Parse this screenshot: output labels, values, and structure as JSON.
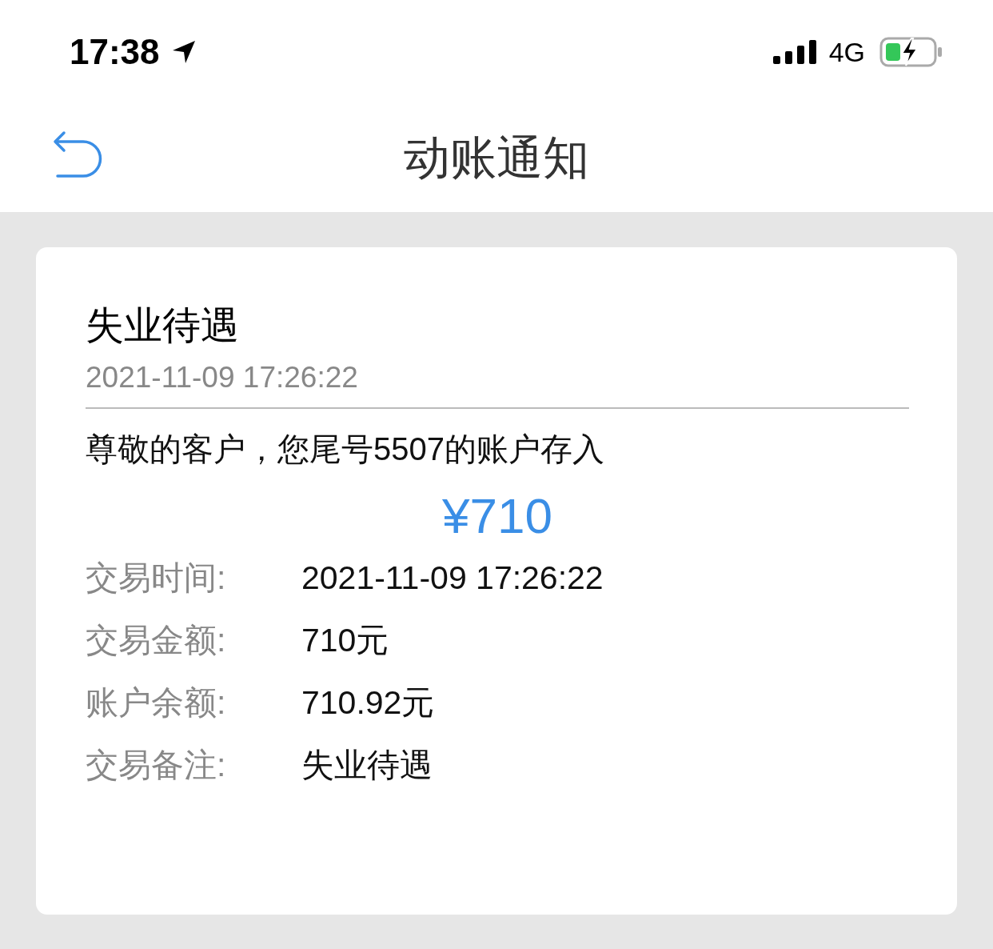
{
  "status_bar": {
    "time": "17:38",
    "network": "4G"
  },
  "nav": {
    "title": "动账通知"
  },
  "card": {
    "title": "失业待遇",
    "timestamp": "2021-11-09 17:26:22",
    "message": "尊敬的客户，您尾号5507的账户存入",
    "amount": "¥710",
    "details": [
      {
        "label": "交易时间:",
        "value": "2021-11-09 17:26:22"
      },
      {
        "label": "交易金额:",
        "value": "710元"
      },
      {
        "label": "账户余额:",
        "value": "710.92元"
      },
      {
        "label": "交易备注:",
        "value": "失业待遇"
      }
    ]
  }
}
